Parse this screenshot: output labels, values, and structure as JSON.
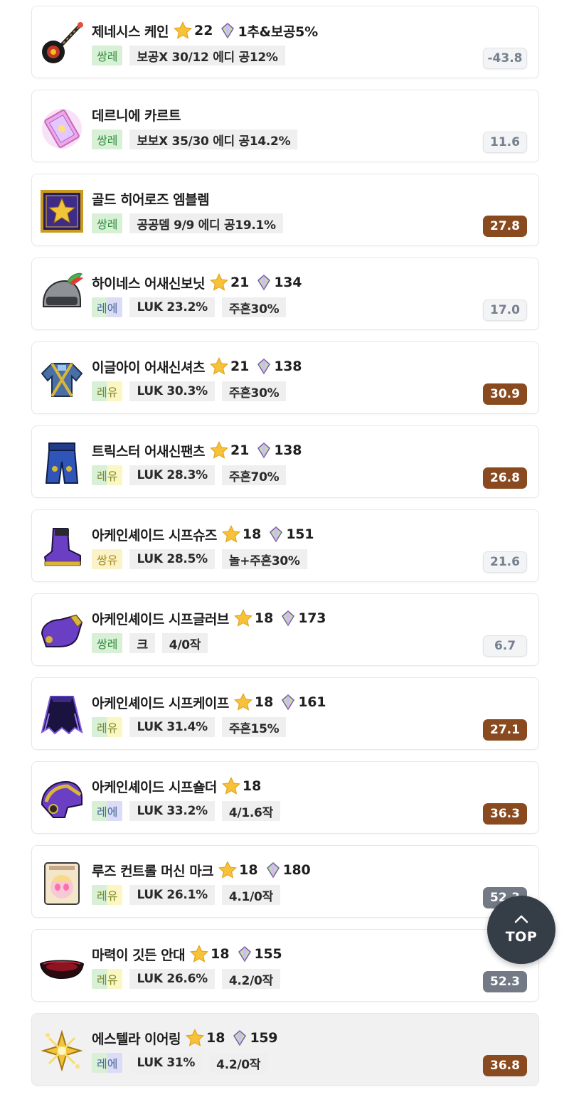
{
  "items": [
    {
      "name": "제네시스 케인",
      "icon": "cane-icon",
      "stars": "22",
      "flames": "1추&보공5%",
      "potential": "쌍레",
      "pot_style": "ll",
      "stats": [
        "보공X 30/12 에디 공12%"
      ],
      "score": "-43.8",
      "score_style": "neutral"
    },
    {
      "name": "데르니에 카르트",
      "icon": "card-icon",
      "stars": "",
      "flames": "",
      "potential": "쌍레",
      "pot_style": "ll",
      "stats": [
        "보보X 35/30 에디 공14.2%"
      ],
      "score": "11.6",
      "score_style": "neutral"
    },
    {
      "name": "골드 히어로즈 엠블렘",
      "icon": "emblem-icon",
      "stars": "",
      "flames": "",
      "potential": "쌍레",
      "pot_style": "ll",
      "stats": [
        "공공뎀 9/9 에디 공19.1%"
      ],
      "score": "27.8",
      "score_style": "good"
    },
    {
      "name": "하이네스 어새신보닛",
      "icon": "helmet-icon",
      "stars": "21",
      "flames": "134",
      "potential": "레에",
      "pot_style": "le",
      "stats": [
        "LUK 23.2%",
        "주흔30%"
      ],
      "score": "17.0",
      "score_style": "neutral"
    },
    {
      "name": "이글아이 어새신셔츠",
      "icon": "shirt-icon",
      "stars": "21",
      "flames": "138",
      "potential": "레유",
      "pot_style": "ly",
      "stats": [
        "LUK 30.3%",
        "주흔30%"
      ],
      "score": "30.9",
      "score_style": "good"
    },
    {
      "name": "트릭스터 어새신팬츠",
      "icon": "pants-icon",
      "stars": "21",
      "flames": "138",
      "potential": "레유",
      "pot_style": "ly",
      "stats": [
        "LUK 28.3%",
        "주흔70%"
      ],
      "score": "26.8",
      "score_style": "good"
    },
    {
      "name": "아케인셰이드 시프슈즈",
      "icon": "shoes-icon",
      "stars": "18",
      "flames": "151",
      "potential": "쌍유",
      "pot_style": "yy",
      "stats": [
        "LUK 28.5%",
        "놀+주흔30%"
      ],
      "score": "21.6",
      "score_style": "neutral"
    },
    {
      "name": "아케인셰이드 시프글러브",
      "icon": "glove-icon",
      "stars": "18",
      "flames": "173",
      "potential": "쌍레",
      "pot_style": "ll",
      "stats": [
        "크",
        "4/0작"
      ],
      "score": "6.7",
      "score_style": "neutral"
    },
    {
      "name": "아케인셰이드 시프케이프",
      "icon": "cape-icon",
      "stars": "18",
      "flames": "161",
      "potential": "레유",
      "pot_style": "ly",
      "stats": [
        "LUK 31.4%",
        "주흔15%"
      ],
      "score": "27.1",
      "score_style": "good"
    },
    {
      "name": "아케인셰이드 시프숄더",
      "icon": "shoulder-icon",
      "stars": "18",
      "flames": "",
      "potential": "레에",
      "pot_style": "le",
      "stats": [
        "LUK 33.2%",
        "4/1.6작"
      ],
      "score": "36.3",
      "score_style": "good"
    },
    {
      "name": "루즈 컨트롤 머신 마크",
      "icon": "face-mark-icon",
      "stars": "18",
      "flames": "180",
      "potential": "레유",
      "pot_style": "ly",
      "stats": [
        "LUK 26.1%",
        "4.1/0작"
      ],
      "score": "52.3",
      "score_style": "dim"
    },
    {
      "name": "마력이 깃든 안대",
      "icon": "eyepatch-icon",
      "stars": "18",
      "flames": "155",
      "potential": "레유",
      "pot_style": "ly",
      "stats": [
        "LUK 26.6%",
        "4.2/0작"
      ],
      "score": "52.3",
      "score_style": "dim"
    },
    {
      "name": "에스텔라 이어링",
      "icon": "earring-icon",
      "stars": "18",
      "flames": "159",
      "potential": "레에",
      "pot_style": "le",
      "stats": [
        "LUK 31%",
        "4.2/0작"
      ],
      "score": "36.8",
      "score_style": "good"
    }
  ],
  "top_button": {
    "label": "TOP",
    "icon": "chevron-up-icon"
  },
  "colors": {
    "score_good": "#8a4a1f",
    "score_neutral": "#f3f4f6",
    "score_dim": "#737a86",
    "top_button": "#353d47"
  }
}
